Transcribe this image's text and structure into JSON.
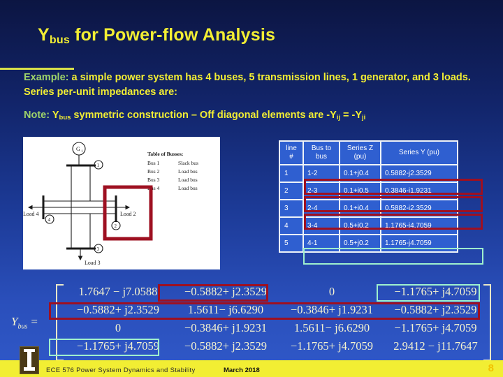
{
  "slide": {
    "title_main": "Y",
    "title_sub": "bus",
    "title_rest": " for Power-flow Analysis",
    "slide_number": "8",
    "accent_yellow": "#f2ee33",
    "accent_green": "#9ed36a",
    "highlight_red": "#9e1021",
    "highlight_mint": "#9ff0cd",
    "table_cell_blue": "#2f5fd0"
  },
  "body": {
    "example_lead": "Example:",
    "example_text": " a simple power system has 4 buses, 5 transmission lines, 1 generator, and 3 loads. Series per-unit impedances are:",
    "note_lead": "Note:",
    "note_y": "Y",
    "note_y_sub": "bus",
    "note_text_1": " symmetric construction – Off diagonal elements are -Y",
    "note_sub_ij": "ij",
    "note_text_2": " = -Y",
    "note_sub_ji": "ji"
  },
  "diagram": {
    "generator_label": "G",
    "generator_sub": "1",
    "bus1_label": "1",
    "bus2_label": "2",
    "bus3_label": "3",
    "bus4_label": "4",
    "load2_label": "Load 2",
    "load3_label": "Load 3",
    "load4_label": "Load 4",
    "bus_table_title": "Table of Busses:",
    "bus_table_rows": [
      {
        "bus": "Bus 1",
        "type": "Slack bus"
      },
      {
        "bus": "Bus 2",
        "type": "Load bus"
      },
      {
        "bus": "Bus 3",
        "type": "Load bus"
      },
      {
        "bus": "Bus 4",
        "type": "Load bus"
      }
    ]
  },
  "table": {
    "headers": [
      "line #",
      "Bus to bus",
      "Series Z (pu)",
      "Series Y (pu)"
    ],
    "header_lines": [
      [
        "line",
        "#"
      ],
      [
        "Bus to",
        "bus"
      ],
      [
        "Series Z",
        "(pu)"
      ],
      [
        "Series Y (pu)",
        ""
      ]
    ],
    "rows": [
      {
        "line": "1",
        "bus": "1-2",
        "z": "0.1+j0.4",
        "y": "0.5882-j2.3529",
        "highlight": "red"
      },
      {
        "line": "2",
        "bus": "2-3",
        "z": "0.1+j0.5",
        "y": "0.3846-j1.9231",
        "highlight": "red"
      },
      {
        "line": "3",
        "bus": "2-4",
        "z": "0.1+j0.4",
        "y": "0.5882-j2.3529",
        "highlight": "red"
      },
      {
        "line": "4",
        "bus": "3-4",
        "z": "0.5+j0.2",
        "y": "1.1765-j4.7059",
        "highlight": "none"
      },
      {
        "line": "5",
        "bus": "4-1",
        "z": "0.5+j0.2",
        "y": "1.1765-j4.7059",
        "highlight": "mint"
      }
    ]
  },
  "matrix": {
    "label_y": "Y",
    "label_sub": "bus",
    "label_eq": "=",
    "rows": [
      [
        "1.7647 − j7.0588",
        "−0.5882+ j2.3529",
        "0",
        "−1.1765+ j4.7059"
      ],
      [
        "−0.5882+ j2.3529",
        "1.5611− j6.6290",
        "−0.3846+ j1.9231",
        "−0.5882+ j2.3529"
      ],
      [
        "0",
        "−0.3846+ j1.9231",
        "1.5611− j6.6290",
        "−1.1765+ j4.7059"
      ],
      [
        "−1.1765+ j4.7059",
        "−0.5882+ j2.3529",
        "−1.1765+ j4.7059",
        "2.9412 − j11.7647"
      ]
    ]
  },
  "footer": {
    "course": "ECE 576 Power System Dynamics and Stability",
    "date": "March 2018"
  }
}
